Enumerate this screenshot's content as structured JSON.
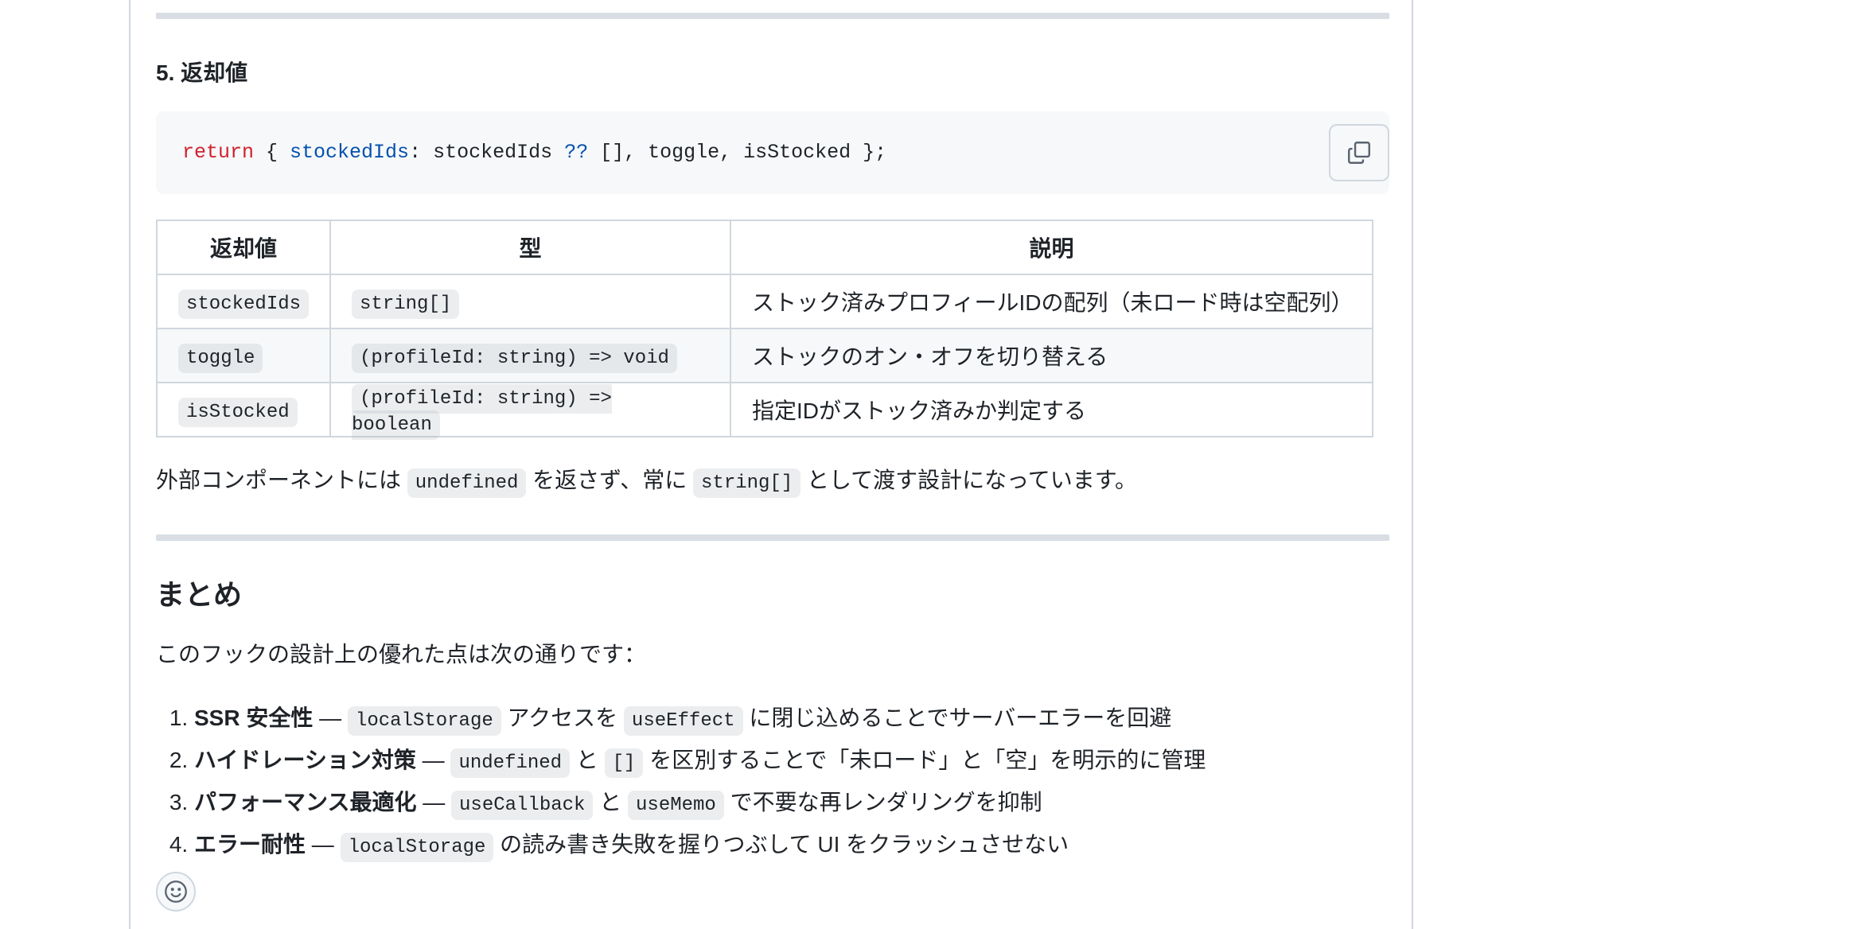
{
  "section": {
    "heading": "5. 返却値"
  },
  "code": {
    "keyword": "return",
    "t1": " { ",
    "prop": "stockedIds",
    "t2": ": stockedIds ",
    "op": "??",
    "t3": " [], toggle, isStocked };",
    "copy_icon": "copy-icon"
  },
  "table": {
    "headers": [
      "返却値",
      "型",
      "説明"
    ],
    "rows": [
      {
        "name": "stockedIds",
        "type": "string[]",
        "desc": "ストック済みプロフィールIDの配列（未ロード時は空配列）"
      },
      {
        "name": "toggle",
        "type": "(profileId: string) => void",
        "desc": "ストックのオン・オフを切り替える"
      },
      {
        "name": "isStocked",
        "type": "(profileId: string) => boolean",
        "desc": "指定IDがストック済みか判定する"
      }
    ]
  },
  "note": {
    "t1": "外部コンポーネントには ",
    "c1": "undefined",
    "t2": " を返さず、常に ",
    "c2": "string[]",
    "t3": " として渡す設計になっています。"
  },
  "summary": {
    "heading": "まとめ",
    "intro": "このフックの設計上の優れた点は次の通りです：",
    "items": [
      {
        "bold": "SSR 安全性",
        "t1": " — ",
        "c1": "localStorage",
        "t2": " アクセスを ",
        "c2": "useEffect",
        "t3": " に閉じ込めることでサーバーエラーを回避"
      },
      {
        "bold": "ハイドレーション対策",
        "t1": " — ",
        "c1": "undefined",
        "t2": " と ",
        "c2": "[]",
        "t3": " を区別することで「未ロード」と「空」を明示的に管理"
      },
      {
        "bold": "パフォーマンス最適化",
        "t1": " — ",
        "c1": "useCallback",
        "t2": " と ",
        "c2": "useMemo",
        "t3": " で不要な再レンダリングを抑制"
      },
      {
        "bold": "エラー耐性",
        "t1": " — ",
        "c1": "localStorage",
        "t2": " の読み書き失敗を握りつぶして UI をクラッシュさせない"
      }
    ]
  },
  "reaction": {
    "icon": "smiley-icon"
  }
}
